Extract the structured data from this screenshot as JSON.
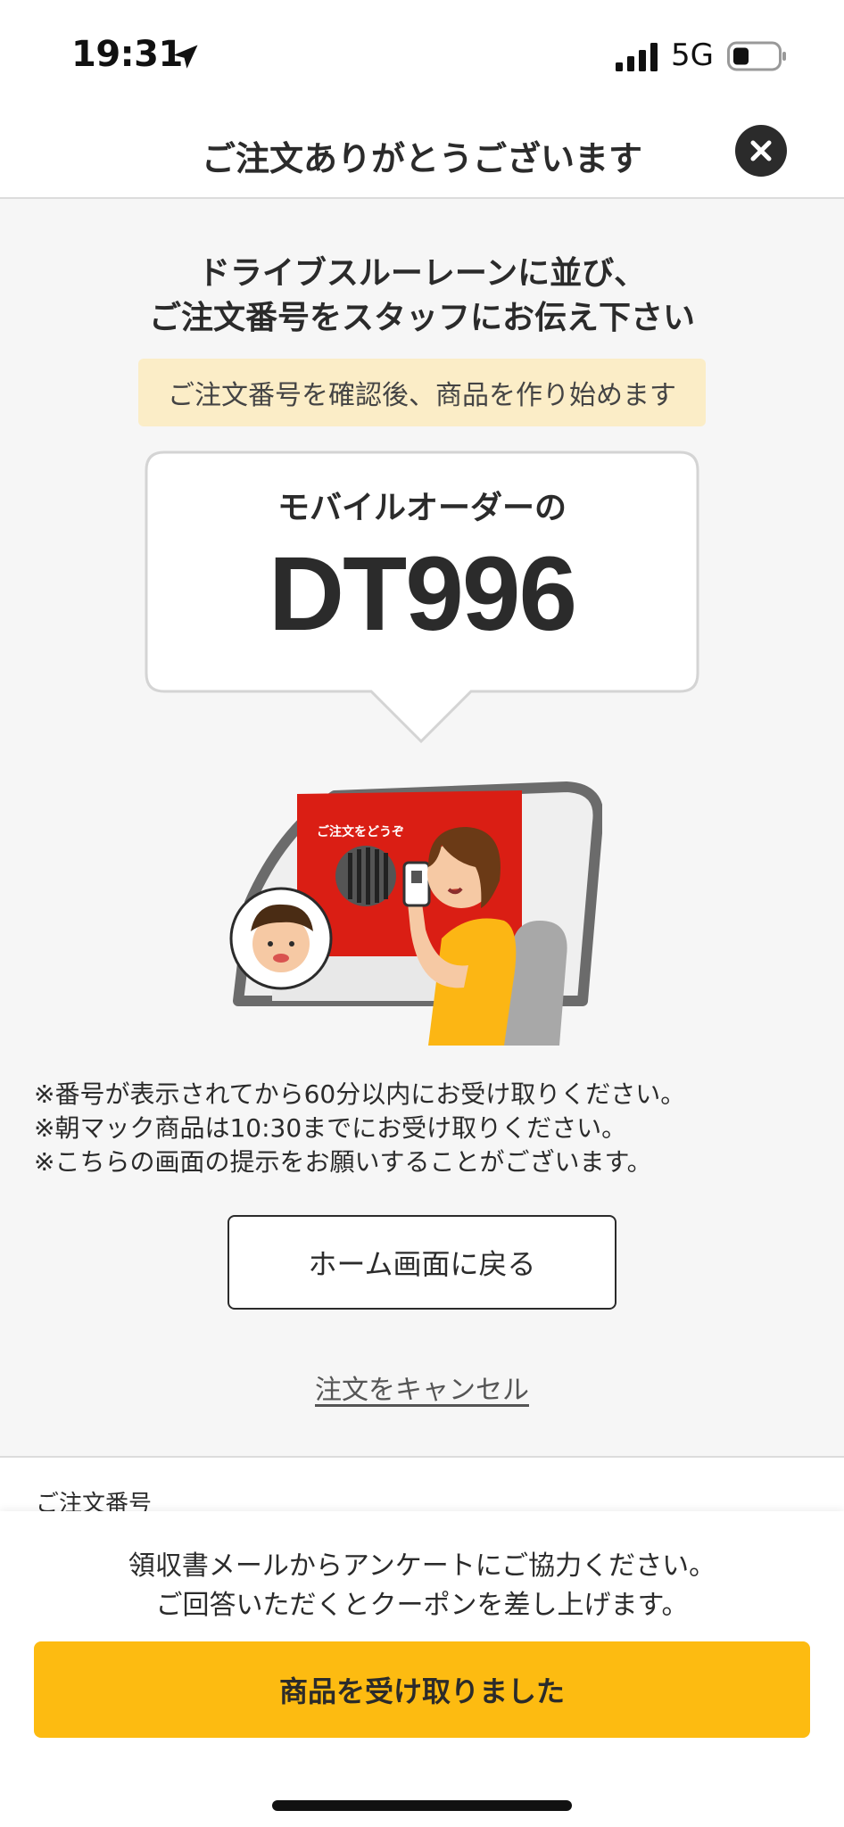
{
  "status_bar": {
    "time": "19:31",
    "network": "5G",
    "icons": [
      "location-arrow-icon",
      "signal-bars-icon",
      "battery-icon"
    ]
  },
  "header": {
    "title": "ご注文ありがとうございます",
    "close_icon": "close-icon"
  },
  "instruction": {
    "line1": "ドライブスルーレーンに並び、",
    "line2": "ご注文番号をスタッフにお伝え下さい"
  },
  "notice": "ご注文番号を確認後、商品を作り始めます",
  "order": {
    "label": "モバイルオーダーの",
    "number": "DT996"
  },
  "illustration": {
    "sign_text": "ご注文をどうぞ"
  },
  "notes": [
    "※番号が表示されてから60分以内にお受け取りください。",
    "※朝マック商品は10:30までにお受け取りください。",
    "※こちらの画面の提示をお願いすることがございます。"
  ],
  "buttons": {
    "home": "ホーム画面に戻る",
    "cancel": "注文をキャンセル",
    "received": "商品を受け取りました"
  },
  "details": {
    "order_number_label": "ご注文番号"
  },
  "survey": {
    "line1": "領収書メールからアンケートにご協力ください。",
    "line2": "ご回答いただくとクーポンを差し上げます。"
  },
  "colors": {
    "accent_yellow": "#fdbb11",
    "notice_bg": "#fbedc7",
    "brand_red": "#da1e14",
    "text_dark": "#2b2b2b"
  }
}
